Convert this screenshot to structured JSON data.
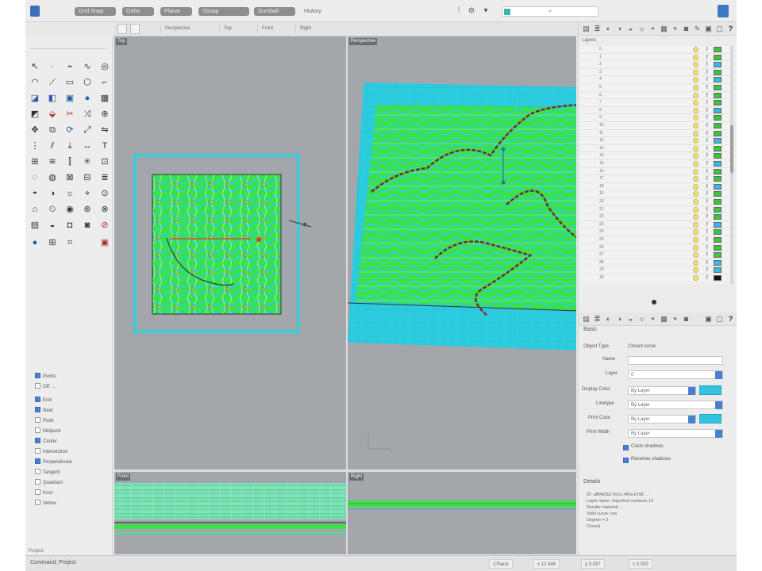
{
  "titlebar": {
    "menu": [
      "Grid Snap",
      "Ortho",
      "Planar",
      "Osnap",
      "Gumball",
      "History"
    ]
  },
  "viewport_tabs": [
    "Perspective",
    "Top",
    "Front",
    "Right"
  ],
  "viewports": {
    "top": "Top",
    "perspective": "Perspective",
    "front": "Front",
    "right": "Right"
  },
  "osnaps": [
    {
      "label": "Points",
      "checked": true
    },
    {
      "label": "Off: ...",
      "checked": false
    },
    {
      "label": "End",
      "checked": true
    },
    {
      "label": "Near",
      "checked": true
    },
    {
      "label": "Point",
      "checked": false
    },
    {
      "label": "Midpoint",
      "checked": false
    },
    {
      "label": "Center",
      "checked": true
    },
    {
      "label": "Intersection",
      "checked": false
    },
    {
      "label": "Perpendicular",
      "checked": true
    },
    {
      "label": "Tangent",
      "checked": false
    },
    {
      "label": "Quadrant",
      "checked": false
    },
    {
      "label": "Knot",
      "checked": false
    },
    {
      "label": "Vertex",
      "checked": false
    }
  ],
  "tools_bottom": "Project",
  "layers": {
    "title": "Layers",
    "rows": [
      {
        "name": "0",
        "color": "#3cc43c"
      },
      {
        "name": "1",
        "color": "#3cc43c"
      },
      {
        "name": "2",
        "color": "#36b8e8"
      },
      {
        "name": "3",
        "color": "#3cc43c"
      },
      {
        "name": "4",
        "color": "#36b8e8"
      },
      {
        "name": "5",
        "color": "#3cc43c"
      },
      {
        "name": "6",
        "color": "#3cc43c"
      },
      {
        "name": "7",
        "color": "#3cc43c"
      },
      {
        "name": "8",
        "color": "#36b8e8"
      },
      {
        "name": "9",
        "color": "#3cc43c"
      },
      {
        "name": "10",
        "color": "#3cc43c"
      },
      {
        "name": "11",
        "color": "#3cc43c"
      },
      {
        "name": "12",
        "color": "#36b8e8"
      },
      {
        "name": "13",
        "color": "#3cc43c"
      },
      {
        "name": "14",
        "color": "#3cc43c"
      },
      {
        "name": "15",
        "color": "#36b8e8"
      },
      {
        "name": "16",
        "color": "#3cc43c"
      },
      {
        "name": "17",
        "color": "#3cc43c"
      },
      {
        "name": "18",
        "color": "#36b8e8"
      },
      {
        "name": "19",
        "color": "#3cc43c"
      },
      {
        "name": "20",
        "color": "#3cc43c"
      },
      {
        "name": "21",
        "color": "#3cc43c"
      },
      {
        "name": "22",
        "color": "#3cc43c"
      },
      {
        "name": "23",
        "color": "#36b8e8"
      },
      {
        "name": "24",
        "color": "#3cc43c"
      },
      {
        "name": "25",
        "color": "#3cc43c"
      },
      {
        "name": "26",
        "color": "#3cc43c"
      },
      {
        "name": "27",
        "color": "#3cc43c"
      },
      {
        "name": "28",
        "color": "#36b8e8"
      },
      {
        "name": "29",
        "color": "#36b8e8"
      },
      {
        "name": "30",
        "color": "#111111"
      }
    ]
  },
  "properties": {
    "section": "Basic",
    "object_type_label": "Object Type",
    "object_type_value": "Closed curve",
    "name_label": "Name",
    "name_value": "",
    "layer_label": "Layer",
    "layer_value": "0",
    "display_color_label": "Display Color",
    "display_color_value": "By Layer",
    "linetype_label": "Linetype",
    "linetype_value": "By Layer",
    "print_color_label": "Print Color",
    "print_color_value": "By Layer",
    "print_width_label": "Print Width",
    "print_width_value": "By Layer",
    "check1": "Casts shadows",
    "check2": "Receives shadows",
    "details_section": "Details",
    "details_lines": [
      "ID: a8f4d3b2-9e1c-4f6a-b7d8 ...",
      "Layer name: Imported contours 19",
      "Render material: ...",
      "Valid curve: yes",
      "Degree = 3",
      "Closed"
    ]
  },
  "statusbar": {
    "command": "Command: Project",
    "cplane": "CPlane",
    "x": "x 12.446",
    "y": "y 3.097",
    "z": "z 0.000"
  },
  "colors": {
    "accent": "#4a7fd0",
    "terrain_green": "#3be04a",
    "terrain_cyan": "#2fcfe0",
    "viewport_bg": "#a3a6ab"
  }
}
